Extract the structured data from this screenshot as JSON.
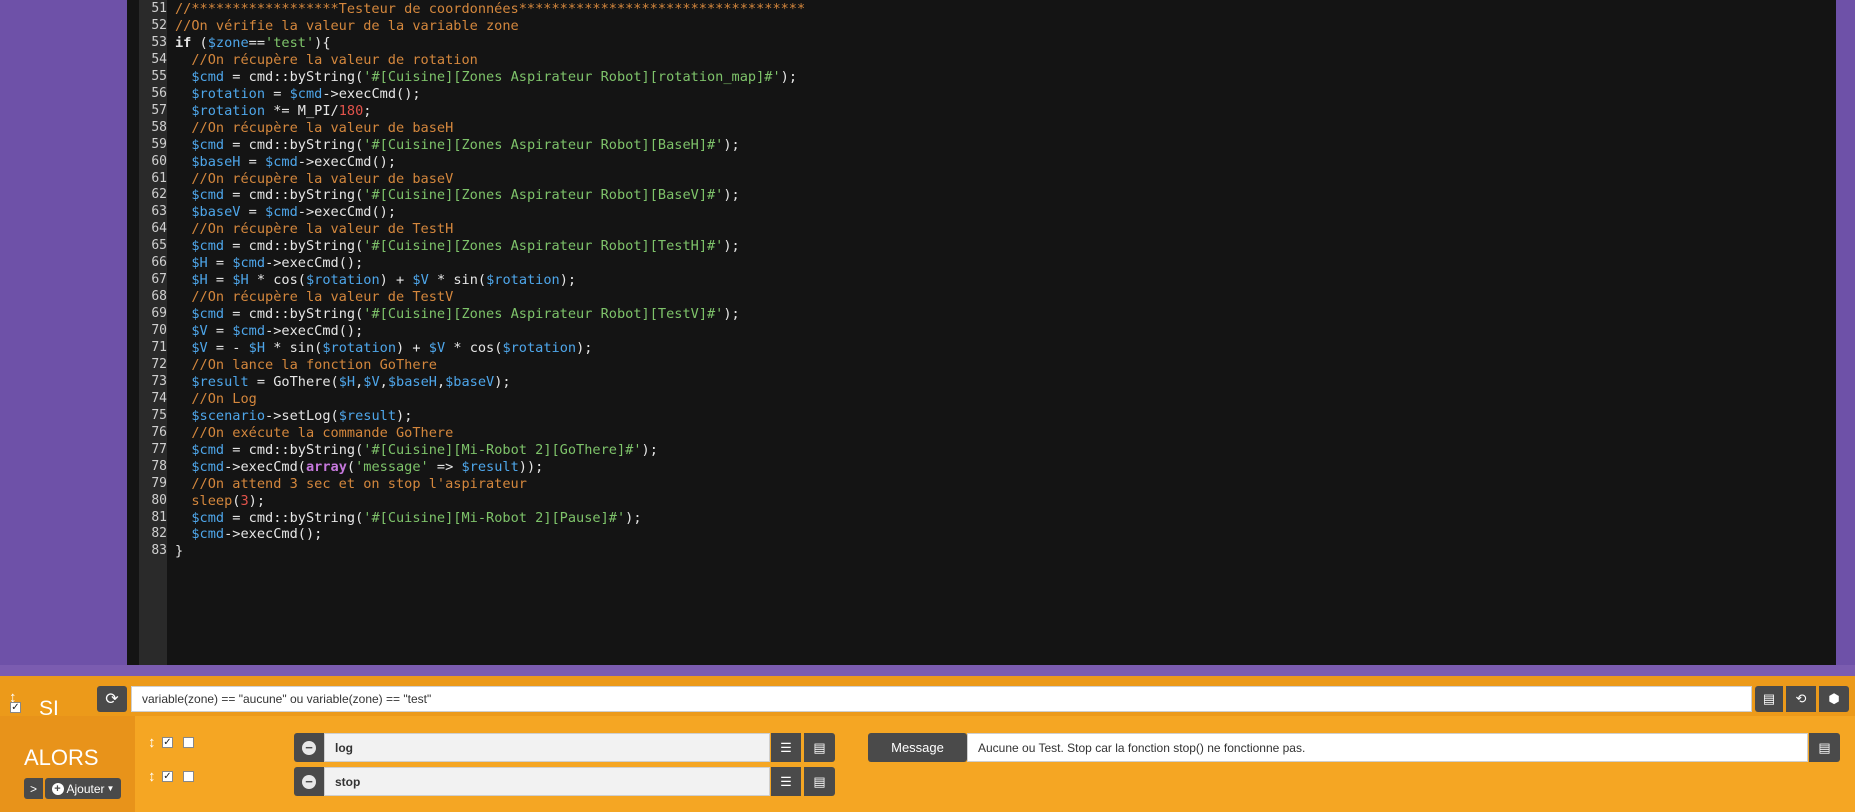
{
  "editor": {
    "lines": [
      {
        "n": "51",
        "t": [
          [
            "cm",
            "//******************Testeur de coordonnées***********************************"
          ]
        ]
      },
      {
        "n": "52",
        "t": [
          [
            "cm",
            "//On vérifie la valeur de la variable zone"
          ]
        ]
      },
      {
        "n": "53",
        "t": [
          [
            "kw",
            "if"
          ],
          [
            "pl",
            " ("
          ],
          [
            "var",
            "$zone"
          ],
          [
            "pl",
            "=="
          ],
          [
            "str",
            "'test'"
          ],
          [
            "pl",
            "){"
          ]
        ]
      },
      {
        "n": "54",
        "t": [
          [
            "cm",
            "  //On récupère la valeur de rotation"
          ]
        ]
      },
      {
        "n": "55",
        "t": [
          [
            "pl",
            "  "
          ],
          [
            "var",
            "$cmd"
          ],
          [
            "pl",
            " = cmd::byString("
          ],
          [
            "str",
            "'#[Cuisine][Zones Aspirateur Robot][rotation_map]#'"
          ],
          [
            "pl",
            ");"
          ]
        ]
      },
      {
        "n": "56",
        "t": [
          [
            "pl",
            "  "
          ],
          [
            "var",
            "$rotation"
          ],
          [
            "pl",
            " = "
          ],
          [
            "var",
            "$cmd"
          ],
          [
            "pl",
            "->execCmd();"
          ]
        ]
      },
      {
        "n": "57",
        "t": [
          [
            "pl",
            "  "
          ],
          [
            "var",
            "$rotation"
          ],
          [
            "pl",
            " *= M_PI/"
          ],
          [
            "num",
            "180"
          ],
          [
            "pl",
            ";"
          ]
        ]
      },
      {
        "n": "58",
        "t": [
          [
            "cm",
            "  //On récupère la valeur de baseH"
          ]
        ]
      },
      {
        "n": "59",
        "t": [
          [
            "pl",
            "  "
          ],
          [
            "var",
            "$cmd"
          ],
          [
            "pl",
            " = cmd::byString("
          ],
          [
            "str",
            "'#[Cuisine][Zones Aspirateur Robot][BaseH]#'"
          ],
          [
            "pl",
            ");"
          ]
        ]
      },
      {
        "n": "60",
        "t": [
          [
            "pl",
            "  "
          ],
          [
            "var",
            "$baseH"
          ],
          [
            "pl",
            " = "
          ],
          [
            "var",
            "$cmd"
          ],
          [
            "pl",
            "->execCmd();"
          ]
        ]
      },
      {
        "n": "61",
        "t": [
          [
            "cm",
            "  //On récupère la valeur de baseV"
          ]
        ]
      },
      {
        "n": "62",
        "t": [
          [
            "pl",
            "  "
          ],
          [
            "var",
            "$cmd"
          ],
          [
            "pl",
            " = cmd::byString("
          ],
          [
            "str",
            "'#[Cuisine][Zones Aspirateur Robot][BaseV]#'"
          ],
          [
            "pl",
            ");"
          ]
        ]
      },
      {
        "n": "63",
        "t": [
          [
            "pl",
            "  "
          ],
          [
            "var",
            "$baseV"
          ],
          [
            "pl",
            " = "
          ],
          [
            "var",
            "$cmd"
          ],
          [
            "pl",
            "->execCmd();"
          ]
        ]
      },
      {
        "n": "64",
        "t": [
          [
            "cm",
            "  //On récupère la valeur de TestH"
          ]
        ]
      },
      {
        "n": "65",
        "t": [
          [
            "pl",
            "  "
          ],
          [
            "var",
            "$cmd"
          ],
          [
            "pl",
            " = cmd::byString("
          ],
          [
            "str",
            "'#[Cuisine][Zones Aspirateur Robot][TestH]#'"
          ],
          [
            "pl",
            ");"
          ]
        ]
      },
      {
        "n": "66",
        "t": [
          [
            "pl",
            "  "
          ],
          [
            "var",
            "$H"
          ],
          [
            "pl",
            " = "
          ],
          [
            "var",
            "$cmd"
          ],
          [
            "pl",
            "->execCmd();"
          ]
        ]
      },
      {
        "n": "67",
        "t": [
          [
            "pl",
            "  "
          ],
          [
            "var",
            "$H"
          ],
          [
            "pl",
            " = "
          ],
          [
            "var",
            "$H"
          ],
          [
            "pl",
            " * cos("
          ],
          [
            "var",
            "$rotation"
          ],
          [
            "pl",
            ") + "
          ],
          [
            "var",
            "$V"
          ],
          [
            "pl",
            " * sin("
          ],
          [
            "var",
            "$rotation"
          ],
          [
            "pl",
            ");"
          ]
        ]
      },
      {
        "n": "68",
        "t": [
          [
            "cm",
            "  //On récupère la valeur de TestV"
          ]
        ]
      },
      {
        "n": "69",
        "t": [
          [
            "pl",
            "  "
          ],
          [
            "var",
            "$cmd"
          ],
          [
            "pl",
            " = cmd::byString("
          ],
          [
            "str",
            "'#[Cuisine][Zones Aspirateur Robot][TestV]#'"
          ],
          [
            "pl",
            ");"
          ]
        ]
      },
      {
        "n": "70",
        "t": [
          [
            "pl",
            "  "
          ],
          [
            "var",
            "$V"
          ],
          [
            "pl",
            " = "
          ],
          [
            "var",
            "$cmd"
          ],
          [
            "pl",
            "->execCmd();"
          ]
        ]
      },
      {
        "n": "71",
        "t": [
          [
            "pl",
            "  "
          ],
          [
            "var",
            "$V"
          ],
          [
            "pl",
            " = - "
          ],
          [
            "var",
            "$H"
          ],
          [
            "pl",
            " * sin("
          ],
          [
            "var",
            "$rotation"
          ],
          [
            "pl",
            ") + "
          ],
          [
            "var",
            "$V"
          ],
          [
            "pl",
            " * cos("
          ],
          [
            "var",
            "$rotation"
          ],
          [
            "pl",
            ");"
          ]
        ]
      },
      {
        "n": "72",
        "t": [
          [
            "cm",
            "  //On lance la fonction GoThere"
          ]
        ]
      },
      {
        "n": "73",
        "t": [
          [
            "pl",
            "  "
          ],
          [
            "var",
            "$result"
          ],
          [
            "pl",
            " = GoThere("
          ],
          [
            "var",
            "$H"
          ],
          [
            "pl",
            ","
          ],
          [
            "var",
            "$V"
          ],
          [
            "pl",
            ","
          ],
          [
            "var",
            "$baseH"
          ],
          [
            "pl",
            ","
          ],
          [
            "var",
            "$baseV"
          ],
          [
            "pl",
            ");"
          ]
        ]
      },
      {
        "n": "74",
        "t": [
          [
            "cm",
            "  //On Log"
          ]
        ]
      },
      {
        "n": "75",
        "t": [
          [
            "pl",
            "  "
          ],
          [
            "var",
            "$scenario"
          ],
          [
            "pl",
            "->setLog("
          ],
          [
            "var",
            "$result"
          ],
          [
            "pl",
            ");"
          ]
        ]
      },
      {
        "n": "76",
        "t": [
          [
            "cm",
            "  //On exécute la commande GoThere"
          ]
        ]
      },
      {
        "n": "77",
        "t": [
          [
            "pl",
            "  "
          ],
          [
            "var",
            "$cmd"
          ],
          [
            "pl",
            " = cmd::byString("
          ],
          [
            "str",
            "'#[Cuisine][Mi-Robot 2][GoThere]#'"
          ],
          [
            "pl",
            ");"
          ]
        ]
      },
      {
        "n": "78",
        "t": [
          [
            "pl",
            "  "
          ],
          [
            "var",
            "$cmd"
          ],
          [
            "pl",
            "->execCmd("
          ],
          [
            "kw2",
            "array"
          ],
          [
            "pl",
            "("
          ],
          [
            "str",
            "'message'"
          ],
          [
            "pl",
            " => "
          ],
          [
            "var",
            "$result"
          ],
          [
            "pl",
            "));"
          ]
        ]
      },
      {
        "n": "79",
        "t": [
          [
            "cm",
            "  //On attend 3 sec et on stop l'aspirateur"
          ]
        ]
      },
      {
        "n": "80",
        "t": [
          [
            "pl",
            "  "
          ],
          [
            "cm",
            "sleep"
          ],
          [
            "pl",
            "("
          ],
          [
            "num",
            "3"
          ],
          [
            "pl",
            ");"
          ]
        ]
      },
      {
        "n": "81",
        "t": [
          [
            "pl",
            "  "
          ],
          [
            "var",
            "$cmd"
          ],
          [
            "pl",
            " = cmd::byString("
          ],
          [
            "str",
            "'#[Cuisine][Mi-Robot 2][Pause]#'"
          ],
          [
            "pl",
            ");"
          ]
        ]
      },
      {
        "n": "82",
        "t": [
          [
            "pl",
            "  "
          ],
          [
            "var",
            "$cmd"
          ],
          [
            "pl",
            "->execCmd();"
          ]
        ]
      },
      {
        "n": "83",
        "t": [
          [
            "pl",
            "}"
          ]
        ]
      }
    ]
  },
  "si": {
    "label": "SI",
    "condition": "variable(zone) == \"aucune\" ou variable(zone) == \"test\""
  },
  "alors": {
    "label": "ALORS",
    "add_label": "Ajouter",
    "actions": [
      {
        "command": "log",
        "option_label": "Message",
        "option_value": "Aucune ou Test. Stop car la fonction stop() ne fonctionne pas."
      },
      {
        "command": "stop"
      }
    ]
  },
  "icons": {
    "refresh": "refresh-icon",
    "list": "list-icon",
    "history": "history-icon",
    "cube": "cube-icon"
  }
}
